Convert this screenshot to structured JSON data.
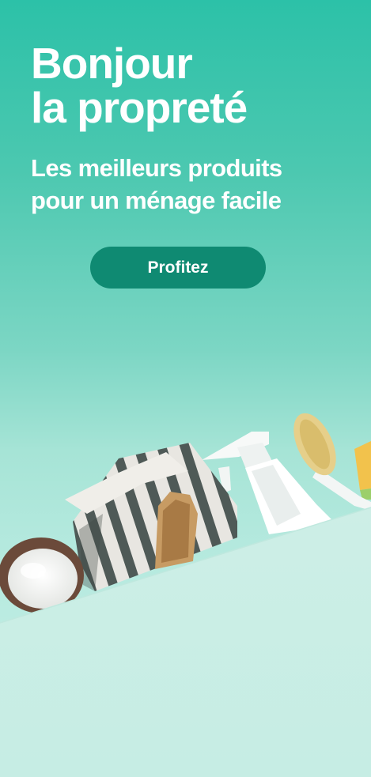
{
  "headline": {
    "line1": "Bonjour",
    "line2": "la propreté"
  },
  "subheadline": {
    "line1": "Les meilleurs produits",
    "line2": "pour un ménage facile"
  },
  "cta": {
    "label": "Profitez"
  },
  "colors": {
    "background_top": "#2cc1a8",
    "background_bottom": "#c9f0e8",
    "cta_background": "#0f8a72",
    "text": "#ffffff"
  },
  "illustration": {
    "items": [
      "powder-bowl",
      "striped-cloth",
      "wooden-scrub-brush",
      "spray-bottle",
      "dish-brush",
      "sponge"
    ]
  }
}
